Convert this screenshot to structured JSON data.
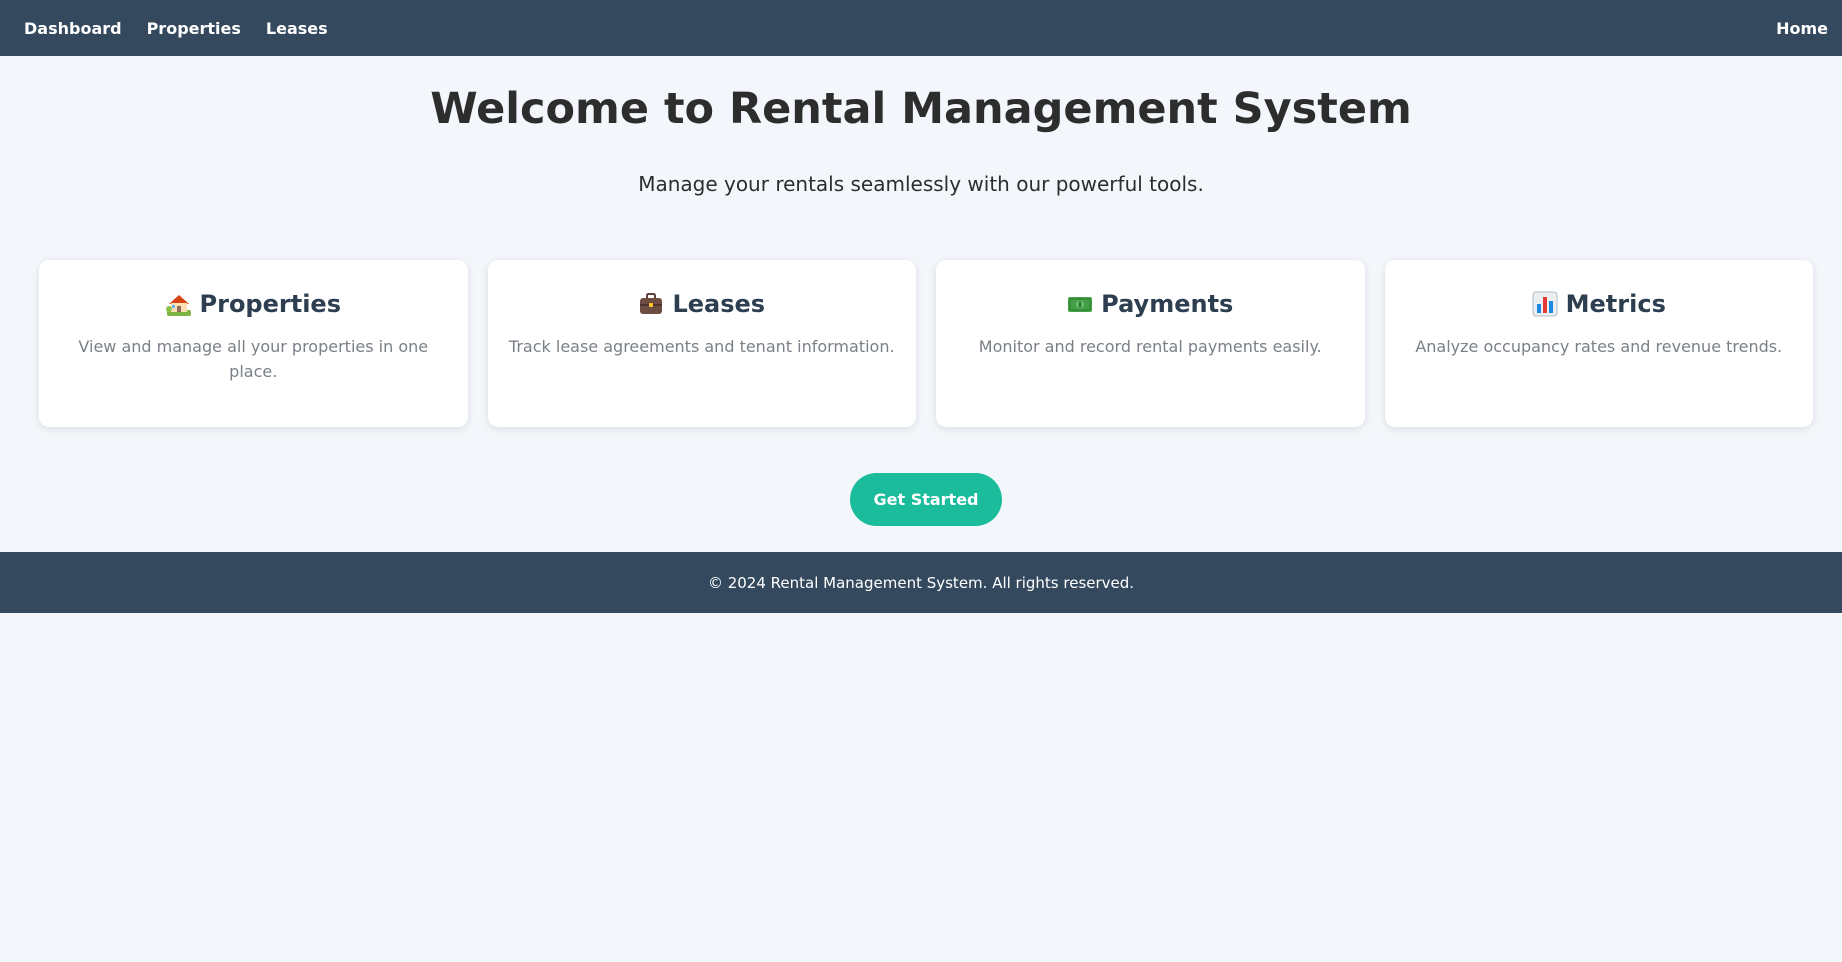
{
  "nav": {
    "links": [
      "Dashboard",
      "Properties",
      "Leases"
    ],
    "home": "Home"
  },
  "hero": {
    "title": "Welcome to Rental Management System",
    "subtitle": "Manage your rentals seamlessly with our powerful tools."
  },
  "cards": [
    {
      "icon": "house-garden-icon",
      "title": "Properties",
      "desc": "View and manage all your properties in one place."
    },
    {
      "icon": "briefcase-icon",
      "title": "Leases",
      "desc": "Track lease agreements and tenant information."
    },
    {
      "icon": "dollar-banknote-icon",
      "title": "Payments",
      "desc": "Monitor and record rental payments easily."
    },
    {
      "icon": "bar-chart-icon",
      "title": "Metrics",
      "desc": "Analyze occupancy rates and revenue trends."
    }
  ],
  "cta": {
    "label": "Get Started"
  },
  "footer": {
    "text": "© 2024 Rental Management System. All rights reserved."
  },
  "colors": {
    "nav_bg": "#34495e",
    "accent": "#1abc9c",
    "page_bg": "#f3f6fa"
  }
}
